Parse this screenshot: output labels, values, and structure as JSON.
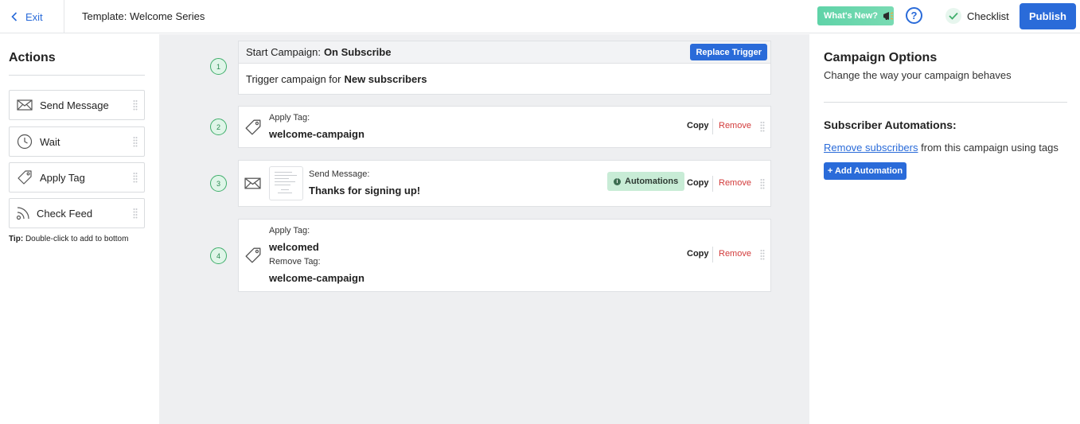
{
  "topbar": {
    "exit_label": "Exit",
    "template_title": "Template: Welcome Series",
    "whats_new_label": "What's New?",
    "help_label": "?",
    "checklist_label": "Checklist",
    "publish_label": "Publish"
  },
  "actions": {
    "title": "Actions",
    "items": [
      {
        "label": "Send Message",
        "icon": "envelope-icon"
      },
      {
        "label": "Wait",
        "icon": "clock-icon"
      },
      {
        "label": "Apply Tag",
        "icon": "tag-icon"
      },
      {
        "label": "Check Feed",
        "icon": "rss-icon"
      }
    ],
    "tip_prefix": "Tip:",
    "tip_text": "Double-click to add to bottom"
  },
  "workflow": {
    "trigger": {
      "step": "1",
      "head_prefix": "Start Campaign:",
      "head_value": "On Subscribe",
      "replace_label": "Replace Trigger",
      "body_prefix": "Trigger campaign for",
      "body_value": "New subscribers"
    },
    "steps": [
      {
        "step": "2",
        "label": "Apply Tag:",
        "value": "welcome-campaign"
      },
      {
        "step": "3",
        "label": "Send Message:",
        "value": "Thanks for signing up!",
        "badge": "Automations"
      },
      {
        "step": "4",
        "label": "Apply Tag:",
        "value": "welcomed",
        "label2": "Remove Tag:",
        "value2": "welcome-campaign"
      }
    ],
    "copy_label": "Copy",
    "remove_label": "Remove"
  },
  "options": {
    "title": "Campaign Options",
    "subtitle": "Change the way your campaign behaves",
    "automations_title": "Subscriber Automations:",
    "link_text": "Remove subscribers",
    "link_suffix": "from this campaign using tags",
    "add_label": "+ Add Automation"
  },
  "colors": {
    "accent": "#2a6bd9",
    "remove": "#d23b3b",
    "step_green": "#3fae6b",
    "canvas_bg": "#eeeff1"
  }
}
